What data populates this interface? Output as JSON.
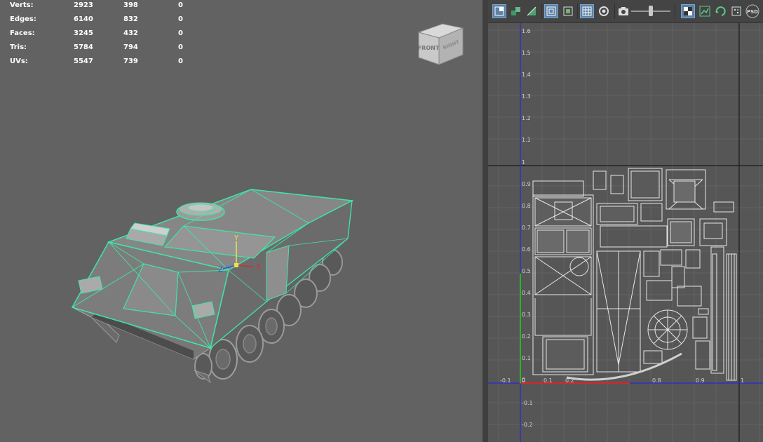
{
  "hud": {
    "rows": [
      {
        "label": "Verts:",
        "v1": "2923",
        "v2": "398",
        "v3": "0"
      },
      {
        "label": "Edges:",
        "v1": "6140",
        "v2": "832",
        "v3": "0"
      },
      {
        "label": "Faces:",
        "v1": "3245",
        "v2": "432",
        "v3": "0"
      },
      {
        "label": "Tris:",
        "v1": "5784",
        "v2": "794",
        "v3": "0"
      },
      {
        "label": "UVs:",
        "v1": "5547",
        "v2": "739",
        "v3": "0"
      }
    ]
  },
  "view_cube": {
    "front_label": "FRONT",
    "right_label": "RIGHT"
  },
  "axes": {
    "x_label": "X",
    "y_label": "Y",
    "z_label": "Z"
  },
  "uv": {
    "v_ticks": [
      "1.6",
      "1.5",
      "1.4",
      "1.3",
      "1.2",
      "1.1",
      "1",
      "0.9",
      "0.8",
      "0.7",
      "0.6",
      "0.5",
      "0.4",
      "0.3",
      "0.2",
      "0.1",
      "0",
      "-0.1",
      "-0.2"
    ],
    "u_ticks": [
      "-0.1",
      "0",
      "0.1",
      "0.2",
      "0.8",
      "0.9",
      "1"
    ],
    "psd_label": "PSD"
  },
  "colors": {
    "wire_highlight": "#3ee6a6",
    "uv_axis_blue": "#2a2ad6",
    "uv_axis_red": "#d02a2a",
    "uv_axis_green": "#2ab52a",
    "active_button": "#5d82a8"
  }
}
